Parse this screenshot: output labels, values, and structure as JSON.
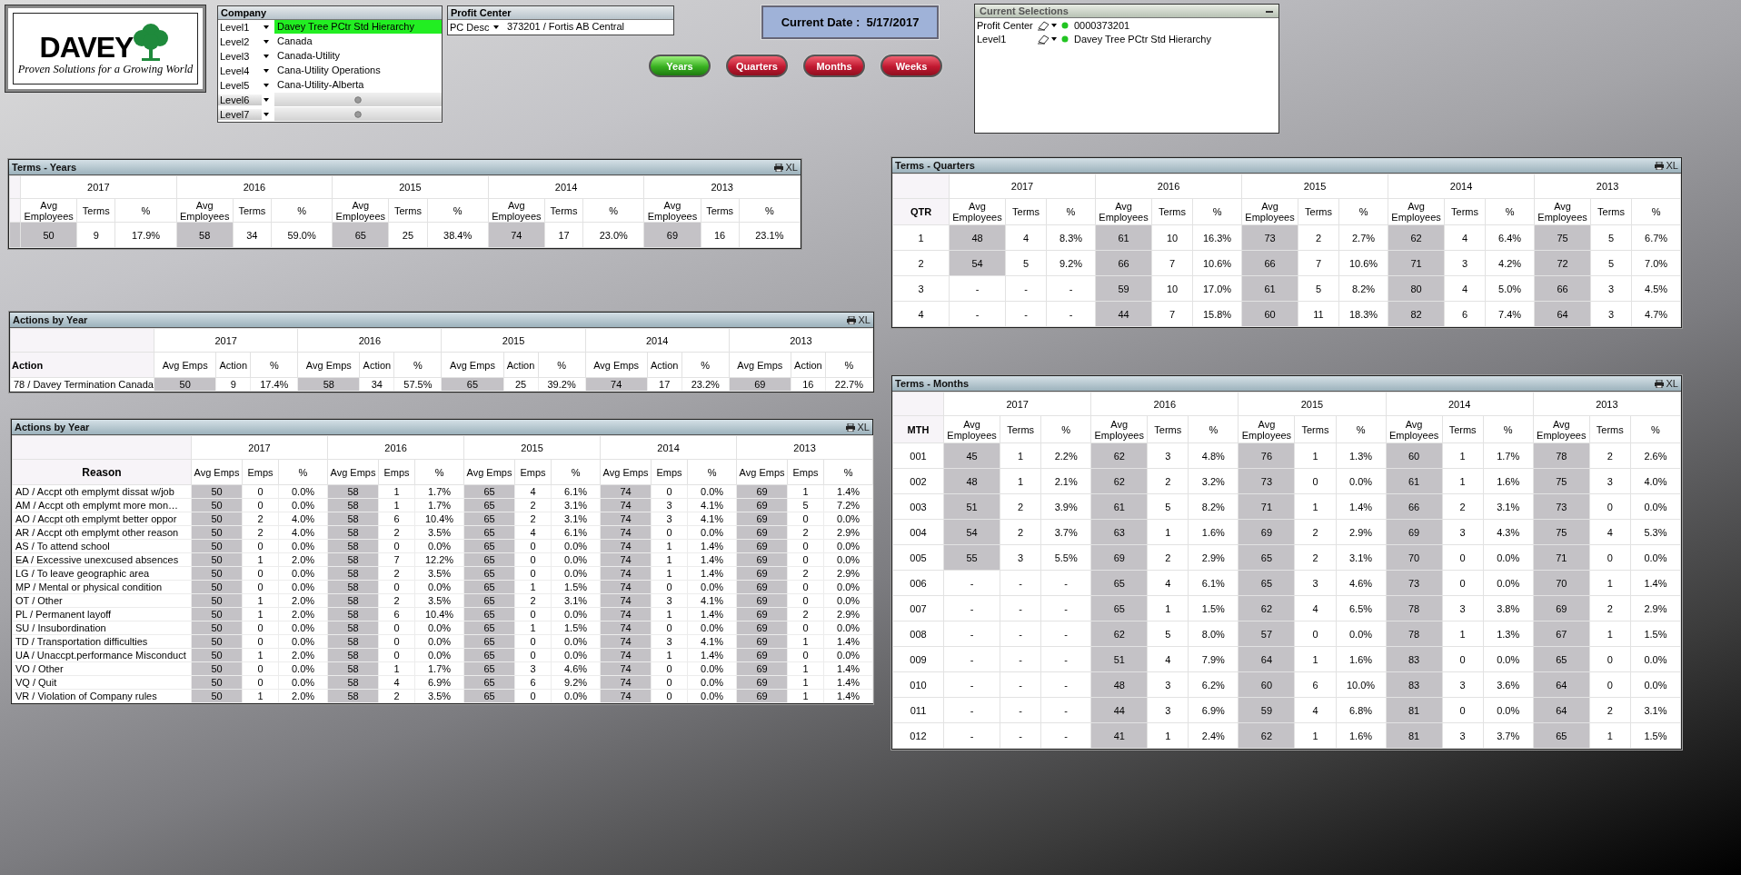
{
  "logo": {
    "brand": "DAVEY",
    "tagline": "Proven Solutions for a *Growing* World"
  },
  "company": {
    "title": "Company",
    "rows": [
      {
        "label": "Level1",
        "kind": "value",
        "value": "Davey Tree PCtr Std Hierarchy",
        "selected": true
      },
      {
        "label": "Level2",
        "kind": "value",
        "value": "Canada",
        "selected": false
      },
      {
        "label": "Level3",
        "kind": "value",
        "value": "Canada-Utility",
        "selected": false
      },
      {
        "label": "Level4",
        "kind": "value",
        "value": "Cana-Utility Operations",
        "selected": false
      },
      {
        "label": "Level5",
        "kind": "value",
        "value": "Cana-Utility-Alberta",
        "selected": false
      },
      {
        "label": "Level6",
        "kind": "empty",
        "selected": false
      },
      {
        "label": "Level7",
        "kind": "empty",
        "selected": false
      }
    ]
  },
  "profit_center": {
    "title": "Profit Center",
    "label": "PC Desc",
    "value": "373201  /  Fortis AB Central"
  },
  "current_date": "Current Date :  5/17/2017",
  "period_buttons": [
    {
      "label": "Years",
      "selected": true
    },
    {
      "label": "Quarters",
      "selected": false
    },
    {
      "label": "Months",
      "selected": false
    },
    {
      "label": "Weeks",
      "selected": false
    }
  ],
  "current_selections": {
    "title": "Current Selections",
    "rows": [
      {
        "field": "Profit Center",
        "value": "0000373201"
      },
      {
        "field": "Level1",
        "value": "Davey Tree PCtr Std Hierarchy"
      }
    ]
  },
  "tables": [
    {
      "title": "Terms - Years",
      "export_label": "XL",
      "years": [
        {
          "label": "2017",
          "columns": [
            "Avg Employees",
            "Terms",
            "%"
          ]
        },
        {
          "label": "2016",
          "columns": [
            "Avg Employees",
            "Terms",
            "%"
          ]
        },
        {
          "label": "2015",
          "columns": [
            "Avg Employees",
            "Terms",
            "%"
          ]
        },
        {
          "label": "2014",
          "columns": [
            "Avg Employees",
            "Terms",
            "%"
          ]
        },
        {
          "label": "2013",
          "columns": [
            "Avg Employees",
            "Terms",
            "%"
          ]
        }
      ],
      "rows": [
        {
          "cells": [
            "50",
            "9",
            "17.9%",
            "58",
            "34",
            "59.0%",
            "65",
            "25",
            "38.4%",
            "74",
            "17",
            "23.0%",
            "69",
            "16",
            "23.1%"
          ]
        }
      ]
    },
    {
      "title": "Actions by Year",
      "export_label": "XL",
      "row_header": "Action",
      "years": [
        {
          "label": "2017",
          "columns": [
            "Avg Emps",
            "Action",
            "%"
          ]
        },
        {
          "label": "2016",
          "columns": [
            "Avg Emps",
            "Action",
            "%"
          ]
        },
        {
          "label": "2015",
          "columns": [
            "Avg Emps",
            "Action",
            "%"
          ]
        },
        {
          "label": "2014",
          "columns": [
            "Avg Emps",
            "Action",
            "%"
          ]
        },
        {
          "label": "2013",
          "columns": [
            "Avg Emps",
            "Action",
            "%"
          ]
        }
      ],
      "rows": [
        {
          "label": "78 / Davey Termination Canada",
          "cells": [
            "50",
            "9",
            "17.4%",
            "58",
            "34",
            "57.5%",
            "65",
            "25",
            "39.2%",
            "74",
            "17",
            "23.2%",
            "69",
            "16",
            "22.7%"
          ]
        }
      ]
    },
    {
      "title": "Actions by Year",
      "export_label": "XL",
      "row_header": "Reason",
      "years": [
        {
          "label": "2017",
          "columns": [
            "Avg Emps",
            "Emps",
            "%"
          ]
        },
        {
          "label": "2016",
          "columns": [
            "Avg Emps",
            "Emps",
            "%"
          ]
        },
        {
          "label": "2015",
          "columns": [
            "Avg Emps",
            "Emps",
            "%"
          ]
        },
        {
          "label": "2014",
          "columns": [
            "Avg Emps",
            "Emps",
            "%"
          ]
        },
        {
          "label": "2013",
          "columns": [
            "Avg Emps",
            "Emps",
            "%"
          ]
        }
      ],
      "rows": [
        {
          "label": "AD / Accpt oth emplymt dissat w/job",
          "cells": [
            "50",
            "0",
            "0.0%",
            "58",
            "1",
            "1.7%",
            "65",
            "4",
            "6.1%",
            "74",
            "0",
            "0.0%",
            "69",
            "1",
            "1.4%"
          ]
        },
        {
          "label": "AM / Accpt oth emplymt more mon…",
          "cells": [
            "50",
            "0",
            "0.0%",
            "58",
            "1",
            "1.7%",
            "65",
            "2",
            "3.1%",
            "74",
            "3",
            "4.1%",
            "69",
            "5",
            "7.2%"
          ]
        },
        {
          "label": "AO / Accpt oth emplymt better oppor",
          "cells": [
            "50",
            "2",
            "4.0%",
            "58",
            "6",
            "10.4%",
            "65",
            "2",
            "3.1%",
            "74",
            "3",
            "4.1%",
            "69",
            "0",
            "0.0%"
          ]
        },
        {
          "label": "AR / Accpt oth emplymt other reason",
          "cells": [
            "50",
            "2",
            "4.0%",
            "58",
            "2",
            "3.5%",
            "65",
            "4",
            "6.1%",
            "74",
            "0",
            "0.0%",
            "69",
            "2",
            "2.9%"
          ]
        },
        {
          "label": "AS / To attend school",
          "cells": [
            "50",
            "0",
            "0.0%",
            "58",
            "0",
            "0.0%",
            "65",
            "0",
            "0.0%",
            "74",
            "1",
            "1.4%",
            "69",
            "0",
            "0.0%"
          ]
        },
        {
          "label": "EA / Excessive unexcused absences",
          "cells": [
            "50",
            "1",
            "2.0%",
            "58",
            "7",
            "12.2%",
            "65",
            "0",
            "0.0%",
            "74",
            "1",
            "1.4%",
            "69",
            "0",
            "0.0%"
          ]
        },
        {
          "label": "LG / To leave geographic area",
          "cells": [
            "50",
            "0",
            "0.0%",
            "58",
            "2",
            "3.5%",
            "65",
            "0",
            "0.0%",
            "74",
            "1",
            "1.4%",
            "69",
            "2",
            "2.9%"
          ]
        },
        {
          "label": "MP / Mental or physical condition",
          "cells": [
            "50",
            "0",
            "0.0%",
            "58",
            "0",
            "0.0%",
            "65",
            "1",
            "1.5%",
            "74",
            "0",
            "0.0%",
            "69",
            "0",
            "0.0%"
          ]
        },
        {
          "label": "OT / Other",
          "cells": [
            "50",
            "1",
            "2.0%",
            "58",
            "2",
            "3.5%",
            "65",
            "2",
            "3.1%",
            "74",
            "3",
            "4.1%",
            "69",
            "0",
            "0.0%"
          ]
        },
        {
          "label": "PL / Permanent layoff",
          "cells": [
            "50",
            "1",
            "2.0%",
            "58",
            "6",
            "10.4%",
            "65",
            "0",
            "0.0%",
            "74",
            "1",
            "1.4%",
            "69",
            "2",
            "2.9%"
          ]
        },
        {
          "label": "SU / Insubordination",
          "cells": [
            "50",
            "0",
            "0.0%",
            "58",
            "0",
            "0.0%",
            "65",
            "1",
            "1.5%",
            "74",
            "0",
            "0.0%",
            "69",
            "0",
            "0.0%"
          ]
        },
        {
          "label": "TD / Transportation difficulties",
          "cells": [
            "50",
            "0",
            "0.0%",
            "58",
            "0",
            "0.0%",
            "65",
            "0",
            "0.0%",
            "74",
            "3",
            "4.1%",
            "69",
            "1",
            "1.4%"
          ]
        },
        {
          "label": "UA / Unaccpt.performance Misconduct",
          "cells": [
            "50",
            "1",
            "2.0%",
            "58",
            "0",
            "0.0%",
            "65",
            "0",
            "0.0%",
            "74",
            "1",
            "1.4%",
            "69",
            "0",
            "0.0%"
          ]
        },
        {
          "label": "VO / Other",
          "cells": [
            "50",
            "0",
            "0.0%",
            "58",
            "1",
            "1.7%",
            "65",
            "3",
            "4.6%",
            "74",
            "0",
            "0.0%",
            "69",
            "1",
            "1.4%"
          ]
        },
        {
          "label": "VQ / Quit",
          "cells": [
            "50",
            "0",
            "0.0%",
            "58",
            "4",
            "6.9%",
            "65",
            "6",
            "9.2%",
            "74",
            "0",
            "0.0%",
            "69",
            "1",
            "1.4%"
          ]
        },
        {
          "label": "VR / Violation of Company rules",
          "cells": [
            "50",
            "1",
            "2.0%",
            "58",
            "2",
            "3.5%",
            "65",
            "0",
            "0.0%",
            "74",
            "0",
            "0.0%",
            "69",
            "1",
            "1.4%"
          ]
        }
      ]
    },
    {
      "title": "Terms - Quarters",
      "export_label": "XL",
      "row_header": "QTR",
      "years": [
        {
          "label": "2017",
          "columns": [
            "Avg Employees",
            "Terms",
            "%"
          ]
        },
        {
          "label": "2016",
          "columns": [
            "Avg Employees",
            "Terms",
            "%"
          ]
        },
        {
          "label": "2015",
          "columns": [
            "Avg Employees",
            "Terms",
            "%"
          ]
        },
        {
          "label": "2014",
          "columns": [
            "Avg Employees",
            "Terms",
            "%"
          ]
        },
        {
          "label": "2013",
          "columns": [
            "Avg Employees",
            "Terms",
            "%"
          ]
        }
      ],
      "rows": [
        {
          "label": "1",
          "cells": [
            "48",
            "4",
            "8.3%",
            "61",
            "10",
            "16.3%",
            "73",
            "2",
            "2.7%",
            "62",
            "4",
            "6.4%",
            "75",
            "5",
            "6.7%"
          ]
        },
        {
          "label": "2",
          "cells": [
            "54",
            "5",
            "9.2%",
            "66",
            "7",
            "10.6%",
            "66",
            "7",
            "10.6%",
            "71",
            "3",
            "4.2%",
            "72",
            "5",
            "7.0%"
          ]
        },
        {
          "label": "3",
          "first_year_blank": true,
          "cells": [
            "-",
            "-",
            "-",
            "59",
            "10",
            "17.0%",
            "61",
            "5",
            "8.2%",
            "80",
            "4",
            "5.0%",
            "66",
            "3",
            "4.5%"
          ]
        },
        {
          "label": "4",
          "first_year_blank": true,
          "cells": [
            "-",
            "-",
            "-",
            "44",
            "7",
            "15.8%",
            "60",
            "11",
            "18.3%",
            "82",
            "6",
            "7.4%",
            "64",
            "3",
            "4.7%"
          ]
        }
      ]
    },
    {
      "title": "Terms - Months",
      "export_label": "XL",
      "row_header": "MTH",
      "years": [
        {
          "label": "2017",
          "columns": [
            "Avg Employees",
            "Terms",
            "%"
          ]
        },
        {
          "label": "2016",
          "columns": [
            "Avg Employees",
            "Terms",
            "%"
          ]
        },
        {
          "label": "2015",
          "columns": [
            "Avg Employees",
            "Terms",
            "%"
          ]
        },
        {
          "label": "2014",
          "columns": [
            "Avg Employees",
            "Terms",
            "%"
          ]
        },
        {
          "label": "2013",
          "columns": [
            "Avg Employees",
            "Terms",
            "%"
          ]
        }
      ],
      "rows": [
        {
          "label": "001",
          "cells": [
            "45",
            "1",
            "2.2%",
            "62",
            "3",
            "4.8%",
            "76",
            "1",
            "1.3%",
            "60",
            "1",
            "1.7%",
            "78",
            "2",
            "2.6%"
          ]
        },
        {
          "label": "002",
          "cells": [
            "48",
            "1",
            "2.1%",
            "62",
            "2",
            "3.2%",
            "73",
            "0",
            "0.0%",
            "61",
            "1",
            "1.6%",
            "75",
            "3",
            "4.0%"
          ]
        },
        {
          "label": "003",
          "cells": [
            "51",
            "2",
            "3.9%",
            "61",
            "5",
            "8.2%",
            "71",
            "1",
            "1.4%",
            "66",
            "2",
            "3.1%",
            "73",
            "0",
            "0.0%"
          ]
        },
        {
          "label": "004",
          "cells": [
            "54",
            "2",
            "3.7%",
            "63",
            "1",
            "1.6%",
            "69",
            "2",
            "2.9%",
            "69",
            "3",
            "4.3%",
            "75",
            "4",
            "5.3%"
          ]
        },
        {
          "label": "005",
          "cells": [
            "55",
            "3",
            "5.5%",
            "69",
            "2",
            "2.9%",
            "65",
            "2",
            "3.1%",
            "70",
            "0",
            "0.0%",
            "71",
            "0",
            "0.0%"
          ]
        },
        {
          "label": "006",
          "first_year_blank": true,
          "cells": [
            "-",
            "-",
            "-",
            "65",
            "4",
            "6.1%",
            "65",
            "3",
            "4.6%",
            "73",
            "0",
            "0.0%",
            "70",
            "1",
            "1.4%"
          ]
        },
        {
          "label": "007",
          "first_year_blank": true,
          "cells": [
            "-",
            "-",
            "-",
            "65",
            "1",
            "1.5%",
            "62",
            "4",
            "6.5%",
            "78",
            "3",
            "3.8%",
            "69",
            "2",
            "2.9%"
          ]
        },
        {
          "label": "008",
          "first_year_blank": true,
          "cells": [
            "-",
            "-",
            "-",
            "62",
            "5",
            "8.0%",
            "57",
            "0",
            "0.0%",
            "78",
            "1",
            "1.3%",
            "67",
            "1",
            "1.5%"
          ]
        },
        {
          "label": "009",
          "first_year_blank": true,
          "cells": [
            "-",
            "-",
            "-",
            "51",
            "4",
            "7.9%",
            "64",
            "1",
            "1.6%",
            "83",
            "0",
            "0.0%",
            "65",
            "0",
            "0.0%"
          ]
        },
        {
          "label": "010",
          "first_year_blank": true,
          "cells": [
            "-",
            "-",
            "-",
            "48",
            "3",
            "6.2%",
            "60",
            "6",
            "10.0%",
            "83",
            "3",
            "3.6%",
            "64",
            "0",
            "0.0%"
          ]
        },
        {
          "label": "011",
          "first_year_blank": true,
          "cells": [
            "-",
            "-",
            "-",
            "44",
            "3",
            "6.9%",
            "59",
            "4",
            "6.8%",
            "81",
            "0",
            "0.0%",
            "64",
            "2",
            "3.1%"
          ]
        },
        {
          "label": "012",
          "first_year_blank": true,
          "cells": [
            "-",
            "-",
            "-",
            "41",
            "1",
            "2.4%",
            "62",
            "1",
            "1.6%",
            "81",
            "3",
            "3.7%",
            "65",
            "1",
            "1.5%"
          ]
        }
      ]
    }
  ]
}
